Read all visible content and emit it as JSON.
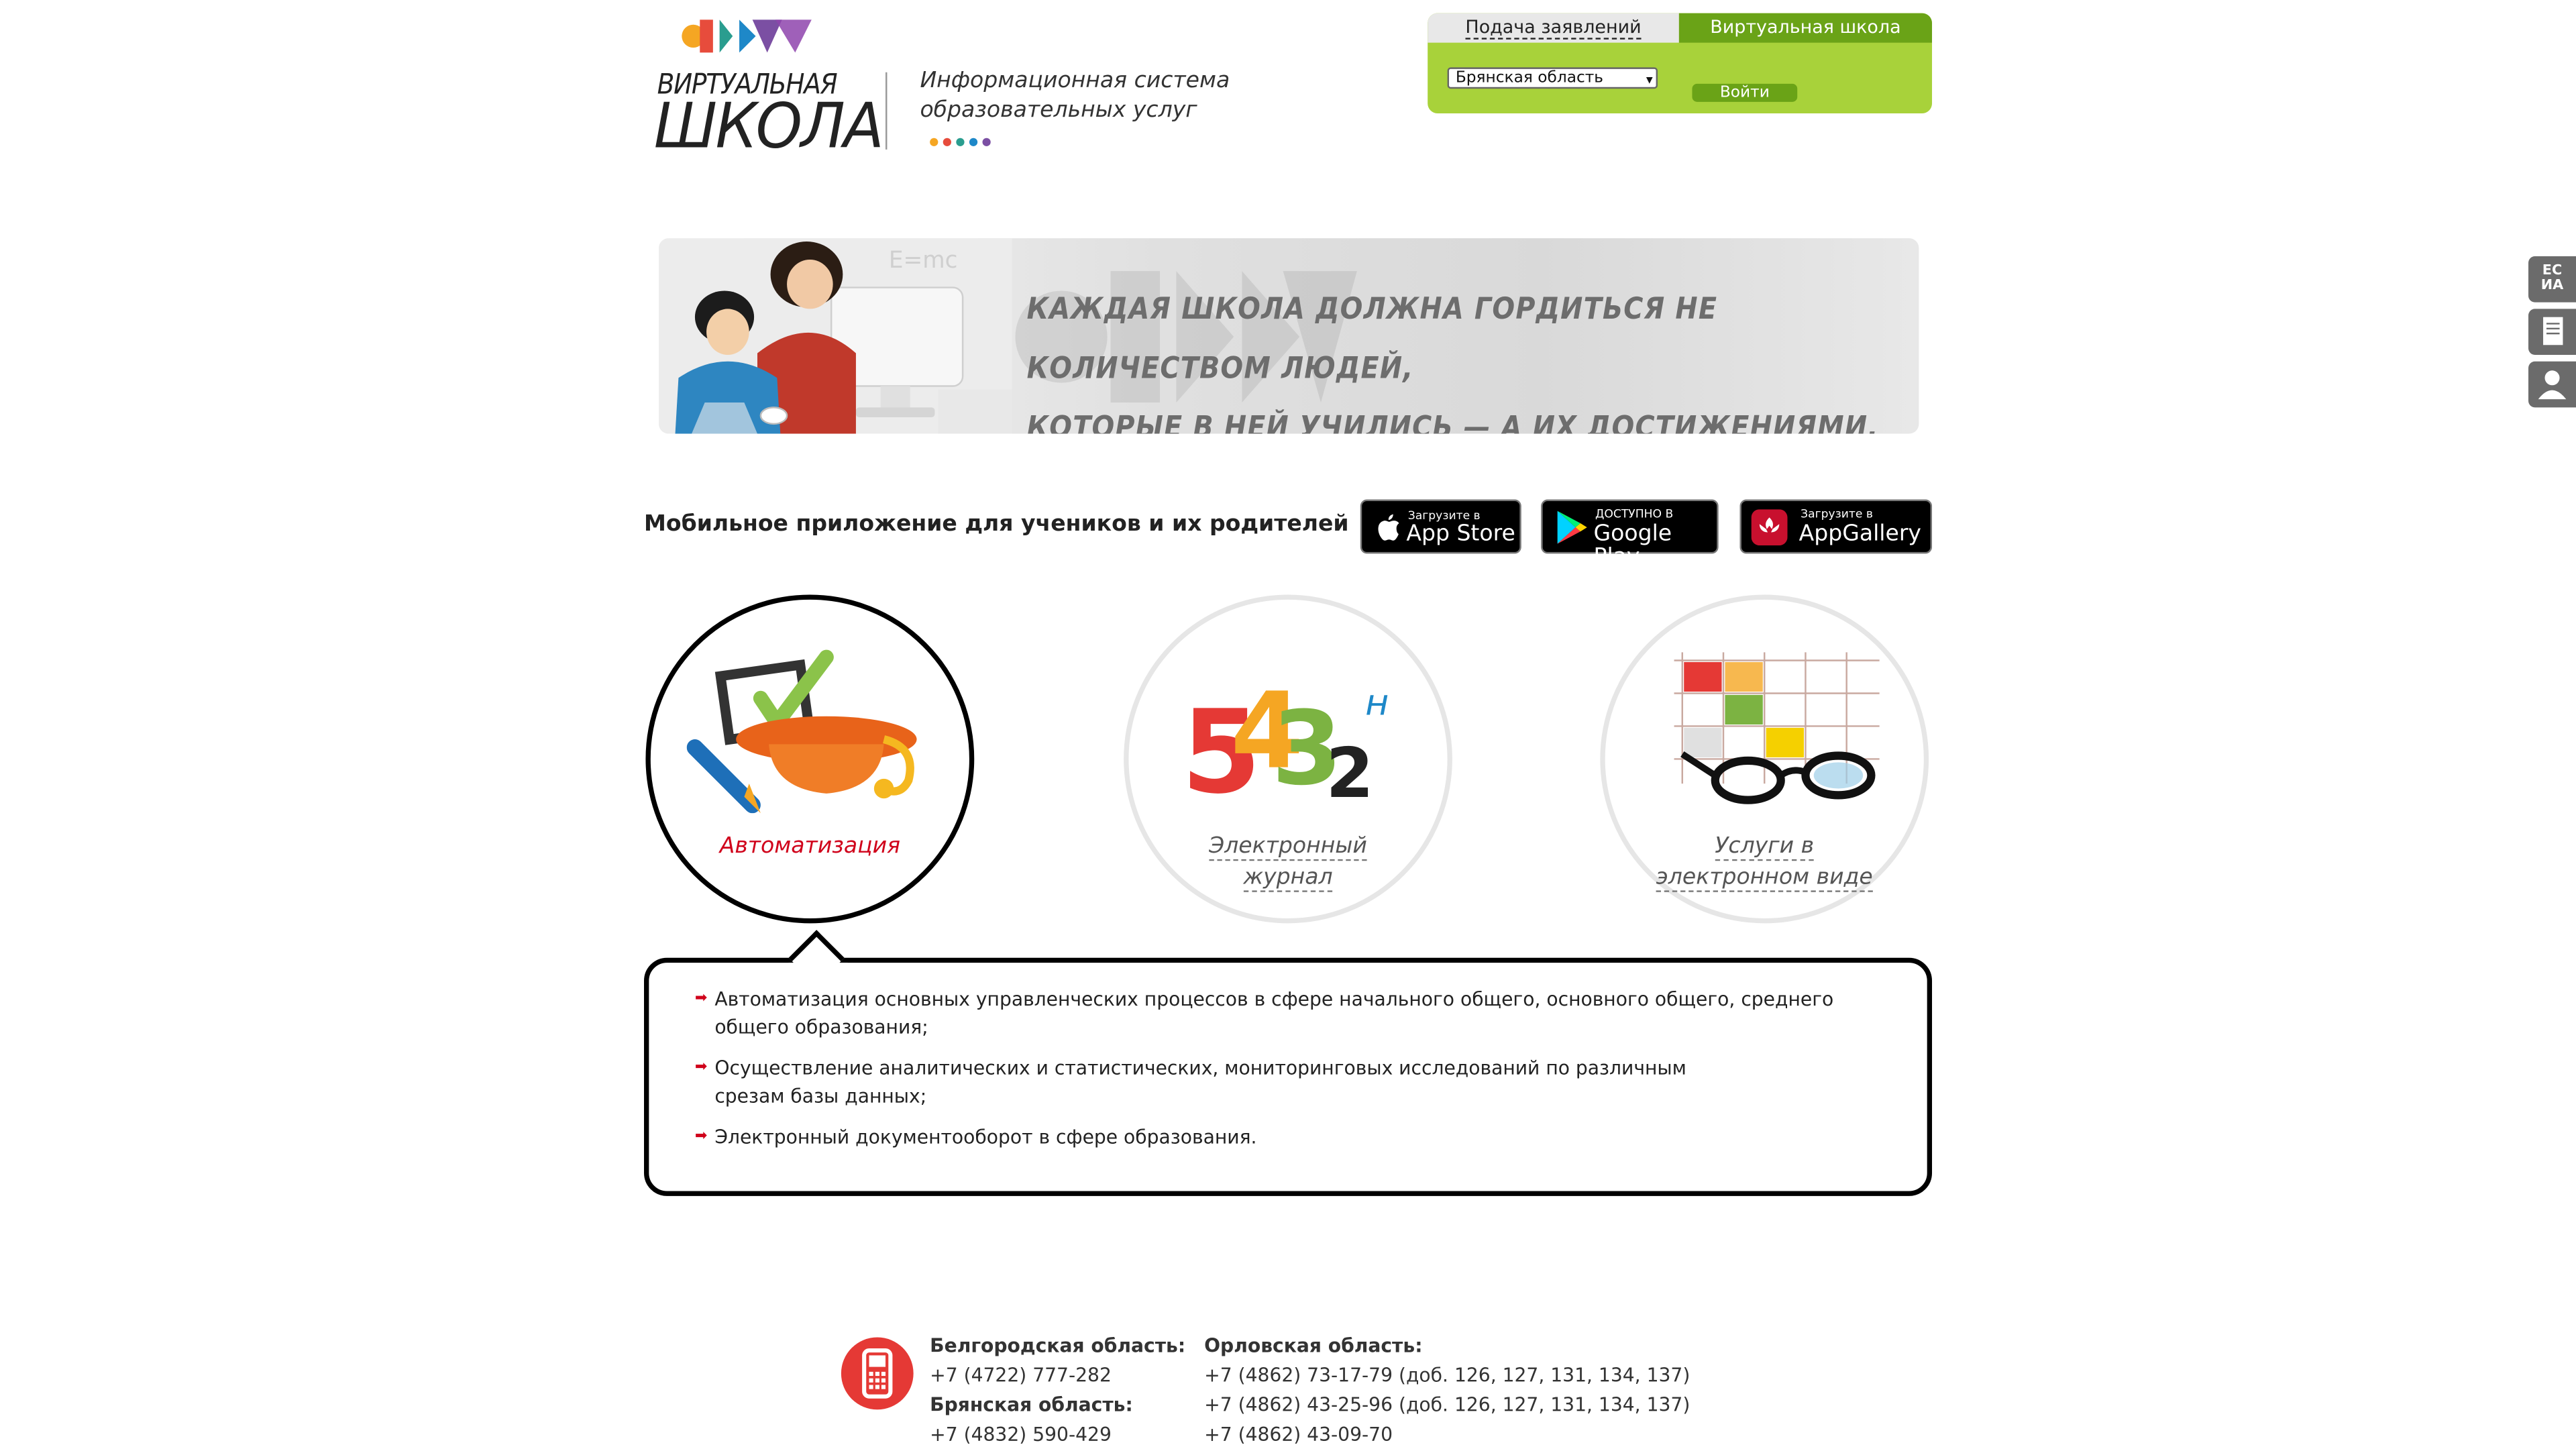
{
  "header": {
    "logo_line1": "ВИРТУАЛЬНАЯ",
    "logo_line2": "ШКОЛА",
    "tagline_line1": "Информационная система",
    "tagline_line2": "образовательных услуг"
  },
  "login": {
    "tab_applications": "Подача заявлений",
    "tab_virtual_school": "Виртуальная школа",
    "region_selected": "Брянская область",
    "login_button": "Войти"
  },
  "banner": {
    "quote_line1": "КАЖДАЯ ШКОЛА ДОЛЖНА ГОРДИТЬСЯ НЕ КОЛИЧЕСТВОМ ЛЮДЕЙ,",
    "quote_line2": "КОТОРЫЕ В НЕЙ УЧИЛИСЬ — А ИХ ДОСТИЖЕНИЯМИ."
  },
  "mobile": {
    "title": "Мобильное приложение для учеников и их родителей",
    "app_store_small": "Загрузите в",
    "app_store_big": "App Store",
    "google_play_small": "ДОСТУПНО В",
    "google_play_big": "Google Play",
    "app_gallery_small": "Загрузите в",
    "app_gallery_big": "AppGallery"
  },
  "features": [
    {
      "label": "Автоматизация",
      "active": true
    },
    {
      "label_line1": "Электронный",
      "label_line2": "журнал",
      "active": false
    },
    {
      "label_line1": "Услуги в",
      "label_line2": "электронном виде",
      "active": false
    }
  ],
  "description": {
    "items": [
      {
        "line1": "Автоматизация основных управленческих процессов в сфере начального общего, основного общего, среднего",
        "line2": "общего образования;"
      },
      {
        "line1": "Осуществление аналитических и статистических, мониторинговых исследований по различным",
        "line2": "срезам базы данных;"
      },
      {
        "line1": "Электронный документооборот в сфере образования."
      }
    ]
  },
  "contacts": {
    "col1": {
      "region1": "Белгородская область:",
      "phone1": "+7 (4722) 777-282",
      "region2": "Брянская область:",
      "phone2": "+7 (4832) 590-429"
    },
    "col2": {
      "region": "Орловская область:",
      "phone1": "+7 (4862) 73-17-79 (доб. 126, 127, 131, 134, 137)",
      "phone2": "+7 (4862) 43-25-96 (доб. 126, 127, 131, 134, 137)",
      "phone3": "+7 (4862) 43-09-70"
    }
  },
  "side": {
    "esia_line1": "ЕС",
    "esia_line2": "ИА"
  },
  "colors": {
    "login_bg": "#a8d23a",
    "login_tab_active": "#6aa317",
    "accent_red": "#d0021b",
    "phone_icon": "#e53935"
  }
}
